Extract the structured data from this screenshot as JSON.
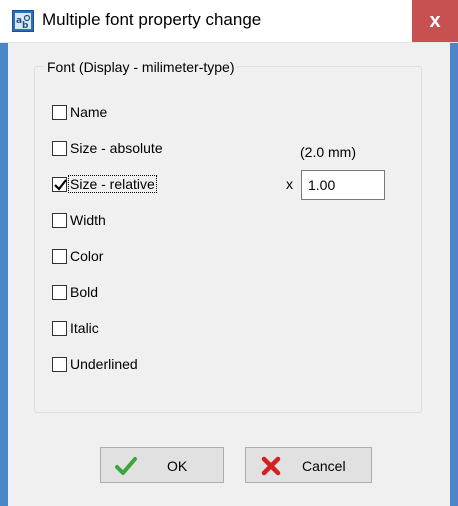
{
  "window": {
    "title": "Multiple font property change",
    "close_label": "x"
  },
  "group": {
    "label": "Font (Display - milimeter-type)"
  },
  "options": [
    {
      "label": "Name",
      "checked": false
    },
    {
      "label": "Size - absolute",
      "checked": false
    },
    {
      "label": "Size - relative",
      "checked": true
    },
    {
      "label": "Width",
      "checked": false
    },
    {
      "label": "Color",
      "checked": false
    },
    {
      "label": "Bold",
      "checked": false
    },
    {
      "label": "Italic",
      "checked": false
    },
    {
      "label": "Underlined",
      "checked": false
    }
  ],
  "size": {
    "absolute_value": "(2.0 mm)",
    "multiplier_label": "x",
    "relative_factor": "1.00"
  },
  "buttons": {
    "ok": "OK",
    "cancel": "Cancel"
  },
  "icons": {
    "title": "font-properties-icon",
    "ok": "green-checkmark-icon",
    "cancel": "red-x-icon"
  },
  "colors": {
    "close_button": "#c75050",
    "dialog_background": "#f0f0f0",
    "window_border": "#4a86c8"
  }
}
